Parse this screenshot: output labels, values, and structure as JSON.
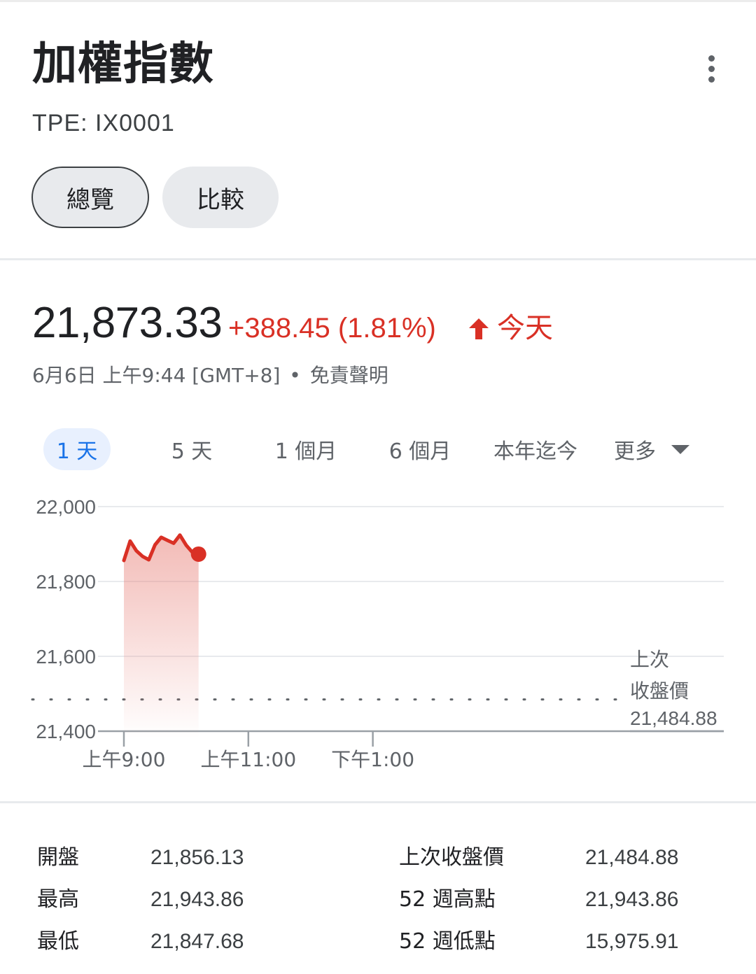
{
  "header": {
    "title": "加權指數",
    "ticker": "TPE: IX0001"
  },
  "tabs": [
    {
      "label": "總覽",
      "selected": true
    },
    {
      "label": "比較",
      "selected": false
    }
  ],
  "quote": {
    "price": "21,873.33",
    "change": "+388.45 (1.81%)",
    "change_direction": "up",
    "period_label": "今天",
    "timestamp": "6月6日 上午9:44 [GMT+8]",
    "disclaimer": "免責聲明",
    "separator": "•"
  },
  "range_tabs": [
    {
      "label": "1 天",
      "selected": true
    },
    {
      "label": "5 天",
      "selected": false
    },
    {
      "label": "1 個月",
      "selected": false
    },
    {
      "label": "6 個月",
      "selected": false
    },
    {
      "label": "本年迄今",
      "selected": false
    },
    {
      "label": "更多",
      "selected": false
    }
  ],
  "chart_data": {
    "type": "area",
    "x_tick_labels": [
      "上午9:00",
      "上午11:00",
      "下午1:00"
    ],
    "y_tick_labels": [
      "22,000",
      "21,800",
      "21,600",
      "21,400"
    ],
    "ylim": [
      21400,
      22000
    ],
    "x_range_minutes": [
      0,
      270
    ],
    "series": [
      {
        "x_minutes": [
          0,
          6,
          12,
          18,
          24,
          30,
          36,
          42,
          48,
          54,
          60,
          66,
          72
        ],
        "values": [
          21856,
          21908,
          21882,
          21867,
          21858,
          21898,
          21918,
          21910,
          21902,
          21924,
          21897,
          21878,
          21873
        ]
      }
    ],
    "previous_close": {
      "label_line1": "上次",
      "label_line2": "收盤價",
      "value": "21,484.88",
      "y": 21484.88
    },
    "grid": true,
    "colors": {
      "line": "#d93025",
      "fill": "#f4c7c3",
      "grid": "#e8eaed",
      "axis": "#9aa0a6"
    }
  },
  "stats": {
    "left": [
      {
        "label": "開盤",
        "value": "21,856.13"
      },
      {
        "label": "最高",
        "value": "21,943.86"
      },
      {
        "label": "最低",
        "value": "21,847.68"
      }
    ],
    "right": [
      {
        "label": "上次收盤價",
        "value": "21,484.88"
      },
      {
        "label": "52 週高點",
        "value": "21,943.86"
      },
      {
        "label": "52 週低點",
        "value": "15,975.91"
      }
    ]
  },
  "colors": {
    "accent": "#1a73e8",
    "positive": "#d93025",
    "text": "#202124",
    "muted": "#5f6368"
  }
}
